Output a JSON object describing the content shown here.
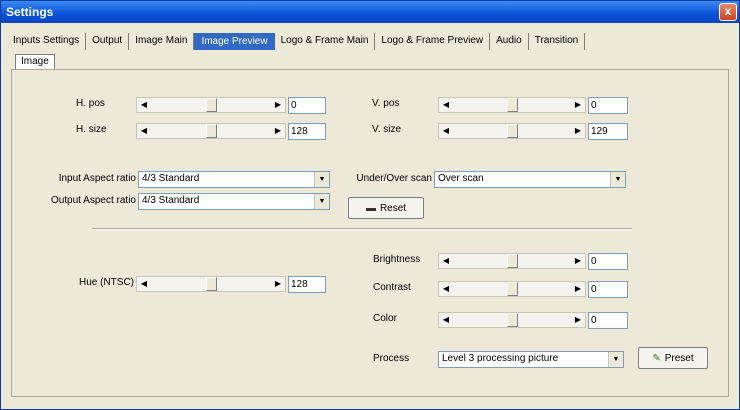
{
  "window": {
    "title": "Settings",
    "close_label": "x"
  },
  "tabs": [
    {
      "label": "Inputs Settings",
      "active": false
    },
    {
      "label": "Output",
      "active": false
    },
    {
      "label": "Image Main",
      "active": false
    },
    {
      "label": "Image Preview",
      "active": true
    },
    {
      "label": "Logo & Frame Main",
      "active": false
    },
    {
      "label": "Logo & Frame Preview",
      "active": false
    },
    {
      "label": "Audio",
      "active": false
    },
    {
      "label": "Transition",
      "active": false
    }
  ],
  "subtab": {
    "label": "Image"
  },
  "position": {
    "h_pos": {
      "label": "H. pos",
      "value": "0",
      "level": 0.5
    },
    "h_size": {
      "label": "H. size",
      "value": "128",
      "level": 0.5
    },
    "v_pos": {
      "label": "V. pos",
      "value": "0",
      "level": 0.5
    },
    "v_size": {
      "label": "V. size",
      "value": "129",
      "level": 0.5
    }
  },
  "aspect": {
    "input_label": "Input Aspect ratio",
    "input_value": "4/3  Standard",
    "output_label": "Output Aspect ratio",
    "output_value": "4/3  Standard",
    "scan_label": "Under/Over scan",
    "scan_value": "Over  scan",
    "reset_label": "Reset"
  },
  "color": {
    "hue": {
      "label": "Hue (NTSC)",
      "value": "128",
      "level": 0.5
    },
    "brightness": {
      "label": "Brightness",
      "value": "0",
      "level": 0.5
    },
    "contrast": {
      "label": "Contrast",
      "value": "0",
      "level": 0.5
    },
    "color": {
      "label": "Color",
      "value": "0",
      "level": 0.5
    },
    "process_label": "Process",
    "process_value": "Level 3 processing picture",
    "preset_label": "Preset"
  }
}
